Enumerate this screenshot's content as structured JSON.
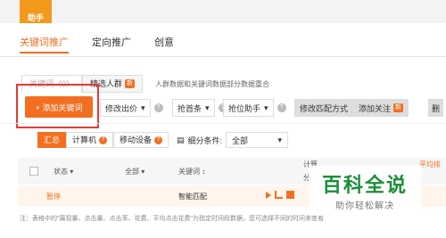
{
  "header": {
    "assistant_tab": "助手"
  },
  "nav": {
    "tabs": [
      "关键词推广",
      "定向推广",
      "创意"
    ]
  },
  "subtabs": {
    "keyword": "关键词（0）",
    "crowd": "精选人群",
    "new_badge": "新",
    "note": "人群数据和关键词数据部分数据重合"
  },
  "toolbar": {
    "add_keyword": "+ 添加关键词",
    "modify_bid": "修改出价",
    "grab_top": "抢首条",
    "grab_position": "抢位助手",
    "modify_match": "修改匹配方式",
    "add_follow": "添加关注",
    "new_badge": "新",
    "delete": "删"
  },
  "segment": {
    "summary": "汇总",
    "computer": "计算机",
    "mobile": "移动设备"
  },
  "filter": {
    "label": "细分条件:",
    "value": "全部"
  },
  "table": {
    "headers": {
      "status": "状态",
      "all": "全部",
      "keyword": "关键词",
      "calc": "计算",
      "share": "分",
      "avg": "平均排"
    },
    "row": {
      "status": "暂停",
      "keyword": "智能匹配"
    }
  },
  "footnote": "注：表格中的\"展现量、点击量、点击率、花费、平均点击花费\"为指定时间段数据，您可选择不同的时间来查看",
  "watermark": {
    "title": "百科全说",
    "subtitle": "助你轻松解决"
  },
  "colors": {
    "accent": "#f26f21",
    "highlight": "#e53935",
    "watermark": "#1a8e3a"
  }
}
